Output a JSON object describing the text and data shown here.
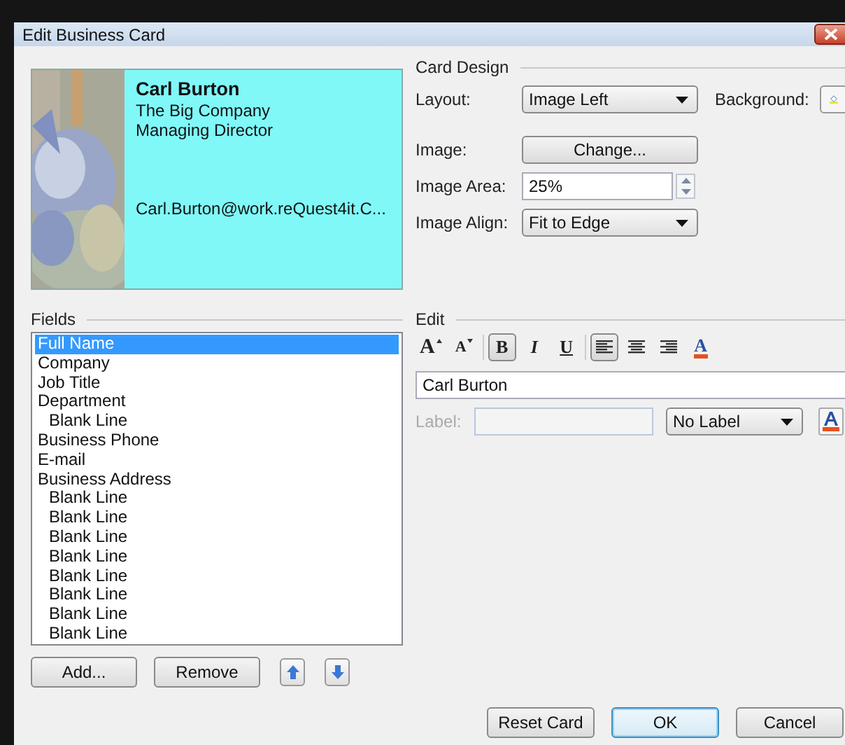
{
  "window": {
    "title": "Edit Business Card"
  },
  "card_preview": {
    "lines": [
      {
        "kind": "line",
        "text": "Carl Burton",
        "bold": true
      },
      {
        "kind": "line",
        "text": "The Big Company",
        "bold": false
      },
      {
        "kind": "line",
        "text": "Managing Director",
        "bold": false
      },
      {
        "kind": "blank"
      },
      {
        "kind": "blank"
      },
      {
        "kind": "blank"
      },
      {
        "kind": "line",
        "text": "Carl.Burton@work.reQuest4it.C...",
        "bold": false
      }
    ]
  },
  "card_design": {
    "title": "Card Design",
    "layout": {
      "label": "Layout:",
      "value": "Image Left"
    },
    "background": {
      "label": "Background:"
    },
    "image": {
      "label": "Image:",
      "button": "Change..."
    },
    "image_area": {
      "label": "Image Area:",
      "value": "25%"
    },
    "image_align": {
      "label": "Image Align:",
      "value": "Fit to Edge"
    }
  },
  "fields": {
    "title": "Fields",
    "items": [
      {
        "label": "Full Name",
        "selected": true
      },
      {
        "label": "Company",
        "selected": false
      },
      {
        "label": "Job Title",
        "selected": false
      },
      {
        "label": "Department",
        "selected": false,
        "children": [
          {
            "label": "Blank Line",
            "selected": false
          }
        ]
      },
      {
        "label": "Business Phone",
        "selected": false
      },
      {
        "label": "E-mail",
        "selected": false
      },
      {
        "label": "Business Address",
        "selected": false,
        "children": [
          {
            "label": "Blank Line",
            "selected": false
          },
          {
            "label": "Blank Line",
            "selected": false
          },
          {
            "label": "Blank Line",
            "selected": false
          },
          {
            "label": "Blank Line",
            "selected": false
          },
          {
            "label": "Blank Line",
            "selected": false
          },
          {
            "label": "Blank Line",
            "selected": false
          },
          {
            "label": "Blank Line",
            "selected": false
          },
          {
            "label": "Blank Line",
            "selected": false
          }
        ]
      }
    ],
    "buttons": [
      {
        "kind": "text",
        "label": "Add..."
      },
      {
        "kind": "text",
        "label": "Remove"
      },
      {
        "kind": "up"
      },
      {
        "kind": "down"
      }
    ]
  },
  "edit": {
    "title": "Edit",
    "toolbar": [
      {
        "kind": "grow",
        "label": "A"
      },
      {
        "kind": "shrink",
        "label": "A"
      },
      {
        "kind": "bold",
        "label": "B",
        "on": true
      },
      {
        "kind": "italic",
        "label": "I",
        "on": false
      },
      {
        "kind": "underline",
        "label": "U",
        "on": false
      },
      {
        "kind": "align-left",
        "on": true
      },
      {
        "kind": "align-center",
        "on": false
      },
      {
        "kind": "align-right",
        "on": false
      },
      {
        "kind": "color",
        "label": "A"
      }
    ],
    "value": "Carl Burton",
    "label_field": {
      "label": "Label:",
      "disabled": true
    },
    "label_position": "No Label"
  },
  "footer_buttons": [
    {
      "label": "Reset Card",
      "default": false
    },
    {
      "label": "OK",
      "default": true
    },
    {
      "label": "Cancel",
      "default": false
    }
  ]
}
